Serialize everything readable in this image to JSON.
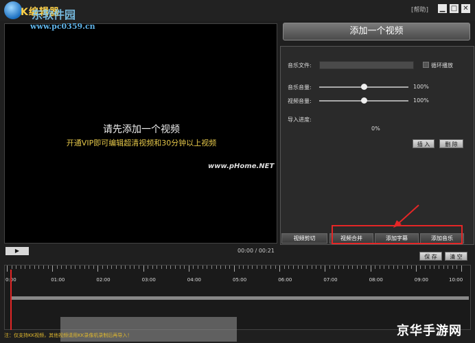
{
  "window": {
    "app_title": "K编辑器",
    "help": "[帮助]",
    "min": "▁",
    "max": "□",
    "close": "✕"
  },
  "watermarks": {
    "top": "东软件园",
    "url": "www.pc0359.cn",
    "mid": "www.pHome.NET",
    "bottom": "京华手游网"
  },
  "preview": {
    "message": "请先添加一个视频",
    "vip_text": "开通VIP即可编辑超清视频和30分钟以上视频"
  },
  "add_video_button": "添加一个视频",
  "music_panel": {
    "music_file_label": "音乐文件:",
    "loop_label": "循环播放",
    "music_volume_label": "音乐音量:",
    "music_volume": "100%",
    "music_volume_fraction": 0.5,
    "video_volume_label": "视频音量:",
    "video_volume": "100%",
    "video_volume_fraction": 0.5,
    "import_progress_label": "导入进度:",
    "progress": "0%",
    "insert_label": "插 入",
    "delete_label": "删 除"
  },
  "tabs": [
    {
      "label": "视频剪切"
    },
    {
      "label": "视频合并"
    },
    {
      "label": "添加字幕"
    },
    {
      "label": "添加音乐"
    }
  ],
  "playback": {
    "play_icon": "▶",
    "time": "00:00 / 00:21"
  },
  "timeline_actions": {
    "save_label": "保 存",
    "clear_label": "清 空"
  },
  "ruler": {
    "labels": [
      "0:00",
      "01:00",
      "02:00",
      "03:00",
      "04:00",
      "05:00",
      "06:00",
      "07:00",
      "08:00",
      "09:00",
      "10:00"
    ]
  },
  "footer": {
    "note": "注：仅支持KK视频，其他视频请用KK录像机录制后再导入！"
  },
  "colors": {
    "highlight": "#e52626",
    "accent_yellow": "#e6c84a"
  }
}
